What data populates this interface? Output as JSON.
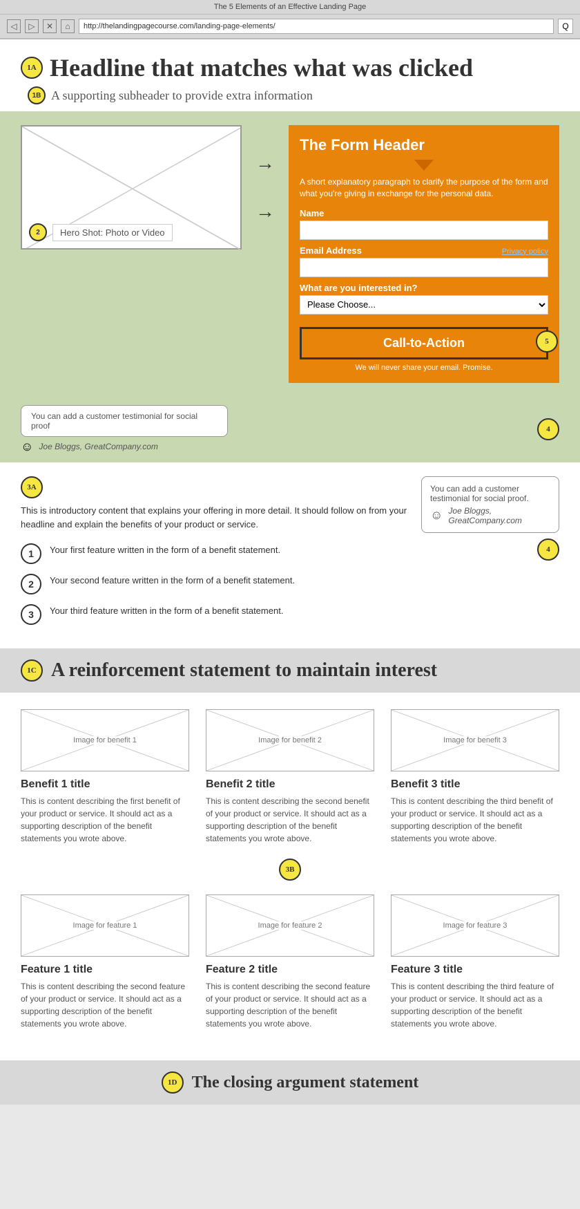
{
  "browser": {
    "title": "The 5 Elements of an Effective Landing Page",
    "url": "http://thelandingpagecourse.com/landing-page-elements/",
    "nav": {
      "back": "◁",
      "forward": "▷",
      "close": "✕",
      "home": "⌂",
      "search": "Q"
    }
  },
  "header": {
    "badge_1a": "1A",
    "headline": "Headline that matches what was clicked",
    "badge_1b": "1B",
    "subheader": "A supporting subheader to provide extra information"
  },
  "form": {
    "title": "The Form Header",
    "description": "A short explanatory paragraph to clarify the purpose of the form and what you're giving in exchange for the personal data.",
    "name_label": "Name",
    "email_label": "Email Address",
    "privacy_label": "Privacy policy",
    "interest_label": "What are you interested in?",
    "interest_placeholder": "Please Choose...",
    "cta_label": "Call-to-Action",
    "badge_5": "5",
    "promise": "We will never share your email. Promise."
  },
  "hero": {
    "badge_2": "2",
    "label": "Hero Shot: Photo or Video"
  },
  "testimonials": {
    "first": {
      "text": "You can add a customer testimonial for social proof",
      "person": "Joe Bloggs, GreatCompany.com",
      "badge": "4"
    },
    "second": {
      "text": "You can add a customer testimonial for social proof.",
      "person": "Joe Bloggs, GreatCompany.com",
      "badge": "4"
    }
  },
  "content": {
    "badge_3a": "3A",
    "intro": "This is introductory content that explains your offering in more detail. It should follow on from your headline and explain the benefits of your product or service.",
    "features": [
      {
        "num": "1",
        "text": "Your first feature written in the form of a benefit statement."
      },
      {
        "num": "2",
        "text": "Your second feature written in the form of a benefit statement."
      },
      {
        "num": "3",
        "text": "Your third feature written in the form of a benefit statement."
      }
    ]
  },
  "reinforcement": {
    "badge_1c": "1C",
    "text": "A reinforcement statement to maintain interest"
  },
  "benefits": {
    "items": [
      {
        "image_label": "Image for benefit 1",
        "title": "Benefit 1 title",
        "desc": "This is content describing the first benefit of your product or service. It should act as a supporting description of the benefit statements you wrote above."
      },
      {
        "image_label": "Image for benefit 2",
        "title": "Benefit 2 title",
        "desc": "This is content describing the second benefit of your product or service. It should act as a supporting description of the benefit statements you wrote above."
      },
      {
        "image_label": "Image for benefit 3",
        "title": "Benefit 3 title",
        "desc": "This is content describing the third benefit of your product or service. It should act as a supporting description of the benefit statements you wrote above."
      }
    ],
    "badge_3b": "3B",
    "features": [
      {
        "image_label": "Image for feature 1",
        "title": "Feature 1 title",
        "desc": "This is content describing the second feature of your product or service. It should act as a supporting description of the benefit statements you wrote above."
      },
      {
        "image_label": "Image for feature 2",
        "title": "Feature 2 title",
        "desc": "This is content describing the second feature of your product or service. It should act as a supporting description of the benefit statements you wrote above."
      },
      {
        "image_label": "Image for feature 3",
        "title": "Feature 3 title",
        "desc": "This is content describing the third feature of your product or service. It should act as a supporting description of the benefit statements you wrote above."
      }
    ]
  },
  "closing": {
    "badge_1d": "1D",
    "text": "The closing argument statement"
  }
}
